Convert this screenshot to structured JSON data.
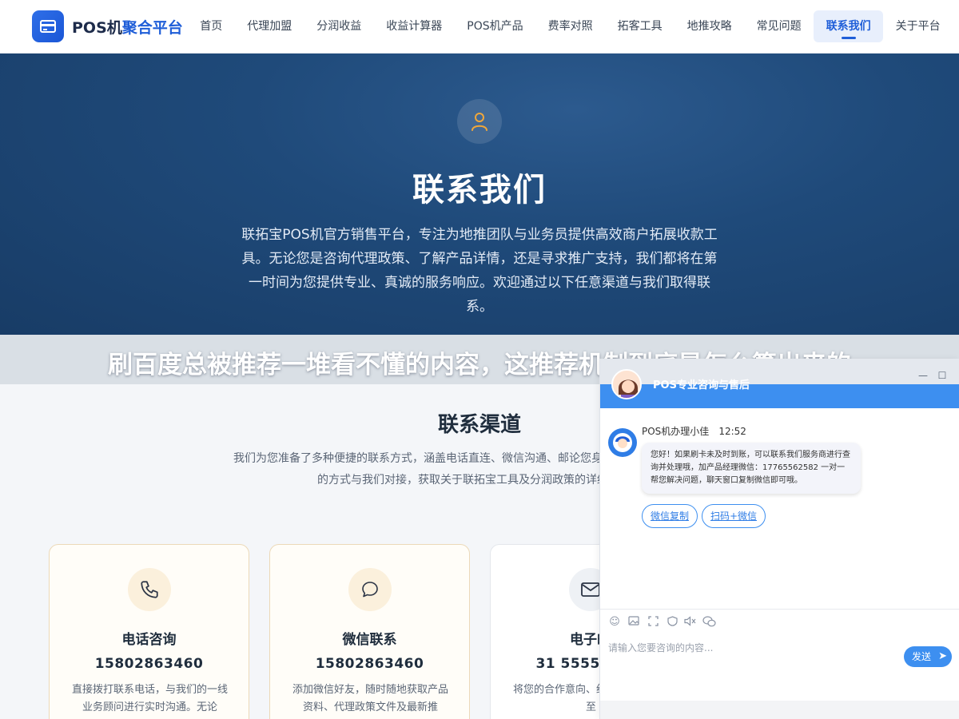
{
  "header": {
    "logo_text": "POS机",
    "logo_accent": "聚合平台",
    "nav": [
      {
        "label": "首页"
      },
      {
        "label": "代理加盟"
      },
      {
        "label": "分润收益"
      },
      {
        "label": "收益计算器"
      },
      {
        "label": "POS机产品"
      },
      {
        "label": "费率对照"
      },
      {
        "label": "拓客工具"
      },
      {
        "label": "地推攻略"
      },
      {
        "label": "常见问题"
      },
      {
        "label": "联系我们",
        "active": true
      },
      {
        "label": "关于平台"
      }
    ]
  },
  "hero": {
    "icon": "user-icon",
    "title": "联系我们",
    "description": "联拓宝POS机官方销售平台，专注为地推团队与业务员提供高效商户拓展收款工具。无论您是咨询代理政策、了解产品详情，还是寻求推广支持，我们都将在第一时间为您提供专业、真诚的服务响应。欢迎通过以下任意渠道与我们取得联系。"
  },
  "overlay": {
    "title": "刷百度总被推荐一堆看不懂的内容，这推荐机制到底是怎么算出来的"
  },
  "channels": {
    "title": "联系渠道",
    "description": "我们为您准备了多种便捷的联系方式，涵盖电话直连、微信沟通、邮论您身处何地，均可选择最适合的方式与我们对接，获取关于联拓宝工具及分润政策的详细解答。",
    "cards": [
      {
        "icon": "phone-icon",
        "title": "电话咨询",
        "value": "15802863460",
        "desc": "直接拨打联系电话，与我们的一线业务顾问进行实时沟通。无论"
      },
      {
        "icon": "chat-bubble-icon",
        "title": "微信联系",
        "value": "15802863460",
        "desc": "添加微信好友，随时随地获取产品资料、代理政策文件及最新推"
      },
      {
        "icon": "mail-icon",
        "title": "电子邮",
        "value": "31 555555 35",
        "desc": "将您的合作意向、细咨询内容发送至"
      }
    ]
  },
  "chat": {
    "header_title": "POS专业咨询与售后",
    "minimize": "—",
    "maximize": "☐",
    "agent_name": "POS机办理小佳",
    "time": "12:52",
    "message": "您好！如果刷卡未及时到账，可以联系我们服务商进行查询并处理哦，加产品经理微信：17765562582 一对一帮您解决问题，聊天窗口复制微信即可哦。",
    "btn_copy": "微信复制",
    "btn_scan": "扫码+微信",
    "tools": [
      "emoji-icon",
      "image-icon",
      "screenshot-icon",
      "rating-icon",
      "voice-icon",
      "wechat-icon"
    ],
    "input_placeholder": "请输入您要咨询的内容...",
    "send_label": "发送"
  },
  "colors": {
    "brand": "#1f5ed8",
    "hero_bg": "#1f4a7a",
    "chat_blue": "#3d8ff0",
    "card_border": "#ecd9b8"
  }
}
